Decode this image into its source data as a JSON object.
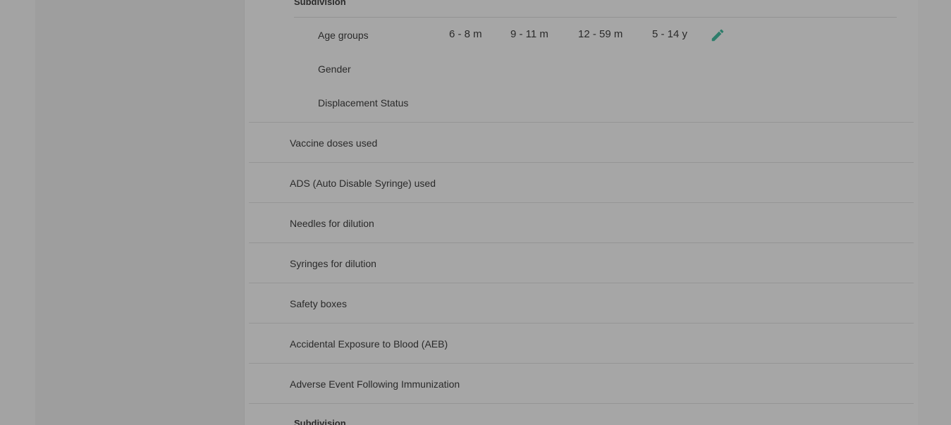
{
  "subdivision": {
    "title": "Subdivision"
  },
  "dimensions": [
    {
      "label": "Age groups"
    },
    {
      "label": "Gender"
    },
    {
      "label": "Displacement Status"
    }
  ],
  "age_groups": [
    "6 - 8 m",
    "9 - 11 m",
    "12 - 59 m",
    "5 - 14 y"
  ],
  "edit_icon": "pencil-icon",
  "accent_color": "#2e7d6b",
  "items": [
    {
      "label": "Vaccine doses used"
    },
    {
      "label": "ADS (Auto Disable Syringe) used"
    },
    {
      "label": "Needles for dilution"
    },
    {
      "label": "Syringes for dilution"
    },
    {
      "label": "Safety boxes"
    },
    {
      "label": "Accidental Exposure to Blood (AEB)"
    },
    {
      "label": "Adverse Event Following Immunization"
    }
  ],
  "subdivision_next": {
    "title": "Subdivision"
  }
}
